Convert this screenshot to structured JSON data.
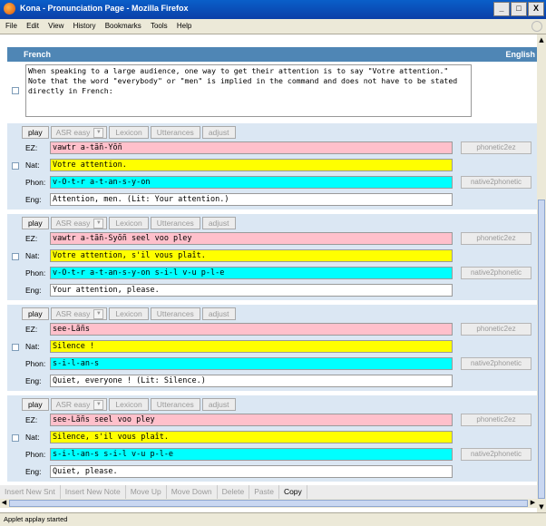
{
  "window": {
    "title": "Kona - Pronunciation Page - Mozilla Firefox",
    "min": "_",
    "max": "□",
    "close": "X"
  },
  "menu": [
    "File",
    "Edit",
    "View",
    "History",
    "Bookmarks",
    "Tools",
    "Help"
  ],
  "header": {
    "left": "French",
    "right": "English"
  },
  "note": "When speaking to a large audience, one way to get their attention is to say \"Votre attention.\" Note that the word \"everybody\" or \"men\" is implied in the command and does not have to be stated directly in French:",
  "controls": {
    "play": "play",
    "asr": "ASR easy",
    "lexicon": "Lexicon",
    "utterances": "Utterances",
    "adjust": "adjust"
  },
  "row_labels": {
    "ez": "EZ:",
    "nat": "Nat:",
    "phon": "Phon:",
    "eng": "Eng:"
  },
  "side_buttons": {
    "phonetic2ez": "phonetic2ez",
    "native2phonetic": "native2phonetic"
  },
  "sentences": [
    {
      "ez": "vawtr a-tãñ-Yõñ",
      "nat": "Votre attention.",
      "phon": "v-O-t-r a-t-an-s-y-on",
      "eng": "Attention, men. (Lit: Your attention.)"
    },
    {
      "ez": "vawtr a-tãñ-Syõñ seel voo pley",
      "nat": "Votre attention, s'il vous plaît.",
      "phon": "v-O-t-r a-t-an-s-y-on s-i-l v-u p-l-e",
      "eng": "Your attention, please."
    },
    {
      "ez": "see-Lãñs",
      "nat": "Silence !",
      "phon": "s-i-l-an-s",
      "eng": "Quiet, everyone ! (Lit: Silence.)"
    },
    {
      "ez": "see-Lãñs seel voo pley",
      "nat": "Silence, s'il vous plaît.",
      "phon": "s-i-l-an-s s-i-l v-u p-l-e",
      "eng": "Quiet, please."
    }
  ],
  "bottom_buttons": [
    "Insert New Snt",
    "Insert New Note",
    "Move Up",
    "Move Down",
    "Delete",
    "Paste",
    "Copy"
  ],
  "status": "Applet applay started",
  "colors": {
    "ez": "#ffc0cb",
    "nat": "#ffff00",
    "phon": "#00ffff",
    "header": "#4f86b5",
    "sentence_bg": "#dbe7f3"
  },
  "icons": {
    "window": "firefox-icon",
    "checkbox": "checkbox-icon",
    "dropdown": "chevron-down-icon"
  }
}
